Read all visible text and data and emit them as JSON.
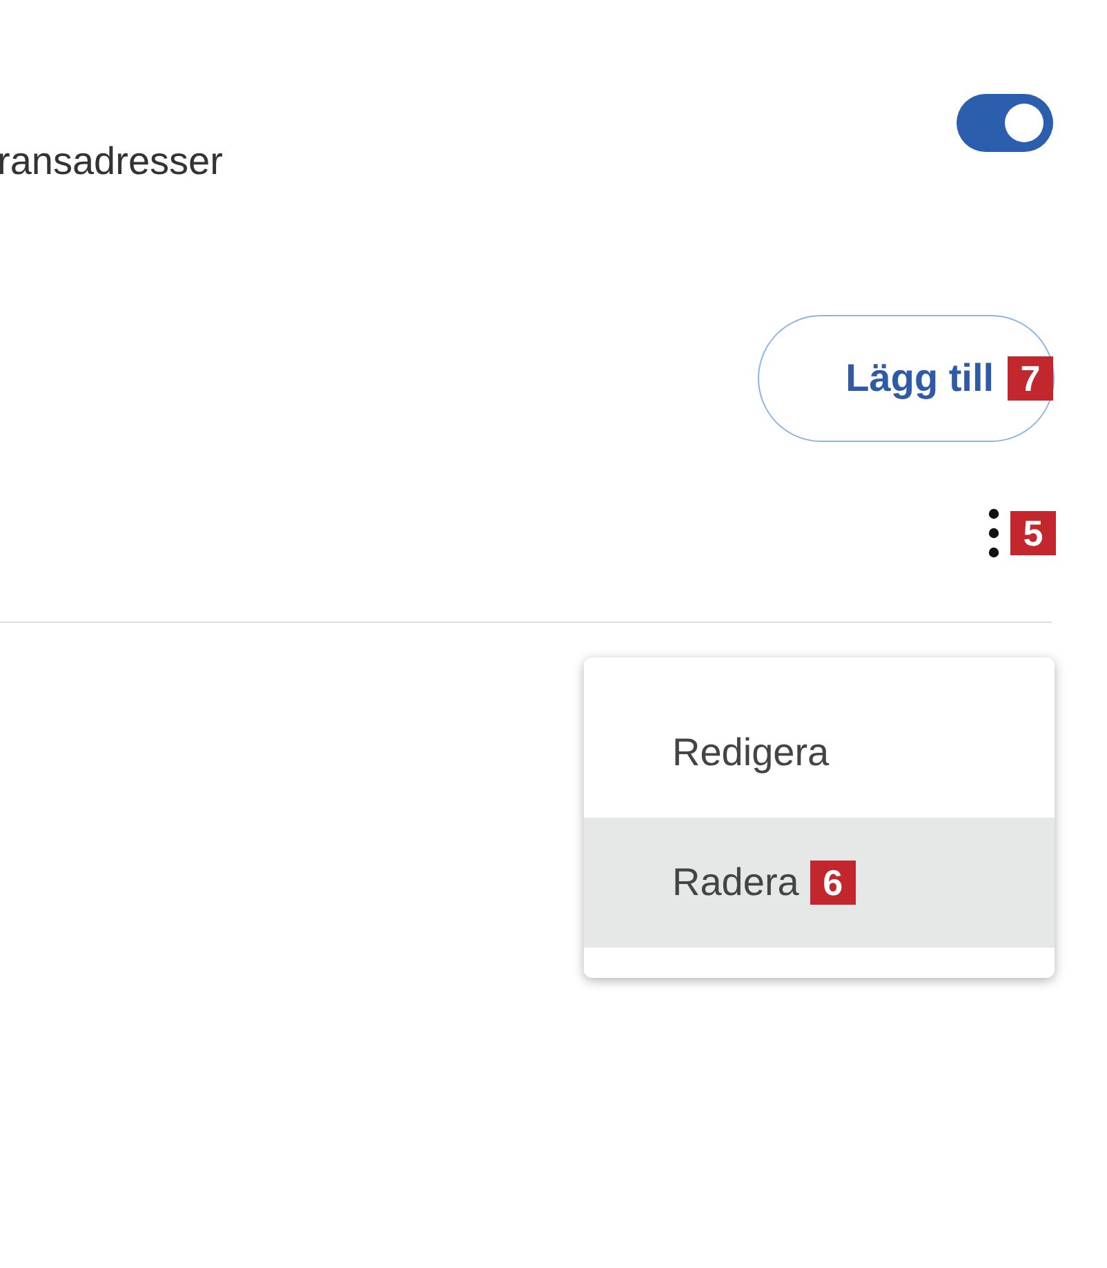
{
  "setting": {
    "label": "ransadresser",
    "on": true
  },
  "add_button": {
    "label": "Lägg till",
    "marker": "7"
  },
  "more_button": {
    "marker": "5"
  },
  "menu": {
    "items": [
      {
        "label": "Redigera",
        "selected": false
      },
      {
        "label": "Radera",
        "selected": true,
        "marker": "6"
      }
    ]
  }
}
